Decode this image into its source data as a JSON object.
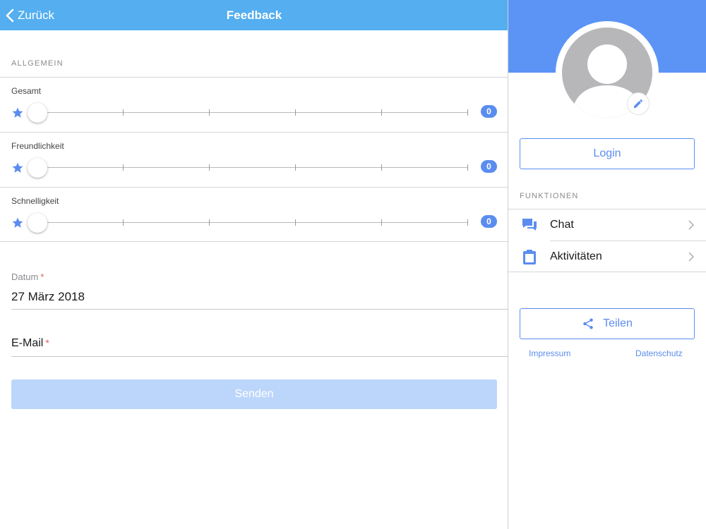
{
  "navbar": {
    "back_label": "Zurück",
    "title": "Feedback"
  },
  "form": {
    "section_header": "ALLGEMEIN",
    "ratings": [
      {
        "label": "Gesamt",
        "value": "0"
      },
      {
        "label": "Freundlichkeit",
        "value": "0"
      },
      {
        "label": "Schnelligkeit",
        "value": "0"
      }
    ],
    "date": {
      "label": "Datum",
      "required_mark": "*",
      "value": "27 März 2018"
    },
    "email": {
      "label": "E-Mail",
      "required_mark": "*",
      "value": ""
    },
    "submit_label": "Senden"
  },
  "sidebar": {
    "login_label": "Login",
    "section_header": "FUNKTIONEN",
    "menu": [
      {
        "label": "Chat",
        "icon": "chat-icon"
      },
      {
        "label": "Aktivitäten",
        "icon": "clipboard-icon"
      }
    ],
    "share_label": "Teilen",
    "links": {
      "impressum": "Impressum",
      "datenschutz": "Datenschutz"
    }
  },
  "colors": {
    "navbar_bg": "#54aeef",
    "sidebar_header_bg": "#5b94f5",
    "accent": "#5b8def",
    "submit_disabled_bg": "#bcd6fb",
    "required": "#e0625d"
  }
}
